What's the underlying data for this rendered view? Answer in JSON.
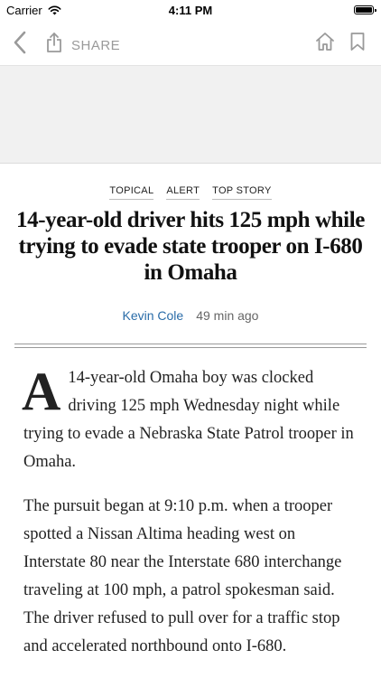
{
  "status_bar": {
    "carrier": "Carrier",
    "time": "4:11 PM"
  },
  "toolbar": {
    "share_label": "SHARE"
  },
  "article": {
    "tags": [
      "TOPICAL",
      "ALERT",
      "TOP STORY"
    ],
    "headline": "14-year-old driver hits 125 mph while trying to evade state trooper on I-680 in Omaha",
    "author": "Kevin Cole",
    "time_ago": "49 min ago",
    "dropcap": "A",
    "paragraph1": "14-year-old Omaha boy was clocked driving 125 mph Wednesday night while trying to evade a Nebraska State Patrol trooper in Omaha.",
    "paragraph2": "The pursuit began at 9:10 p.m. when a trooper spotted a Nissan Altima heading west on Interstate 80 near the Interstate 680 interchange traveling at 100 mph, a patrol spokesman said. The driver refused to pull over for a traffic stop and accelerated northbound onto I-680."
  },
  "colors": {
    "author_link": "#2a6ca8",
    "toolbar_icon": "#9a9a9a",
    "ad_background": "#f1f1f1"
  },
  "icons": [
    "back-chevron-icon",
    "share-icon",
    "home-icon",
    "bookmark-icon",
    "wifi-icon",
    "battery-icon"
  ]
}
